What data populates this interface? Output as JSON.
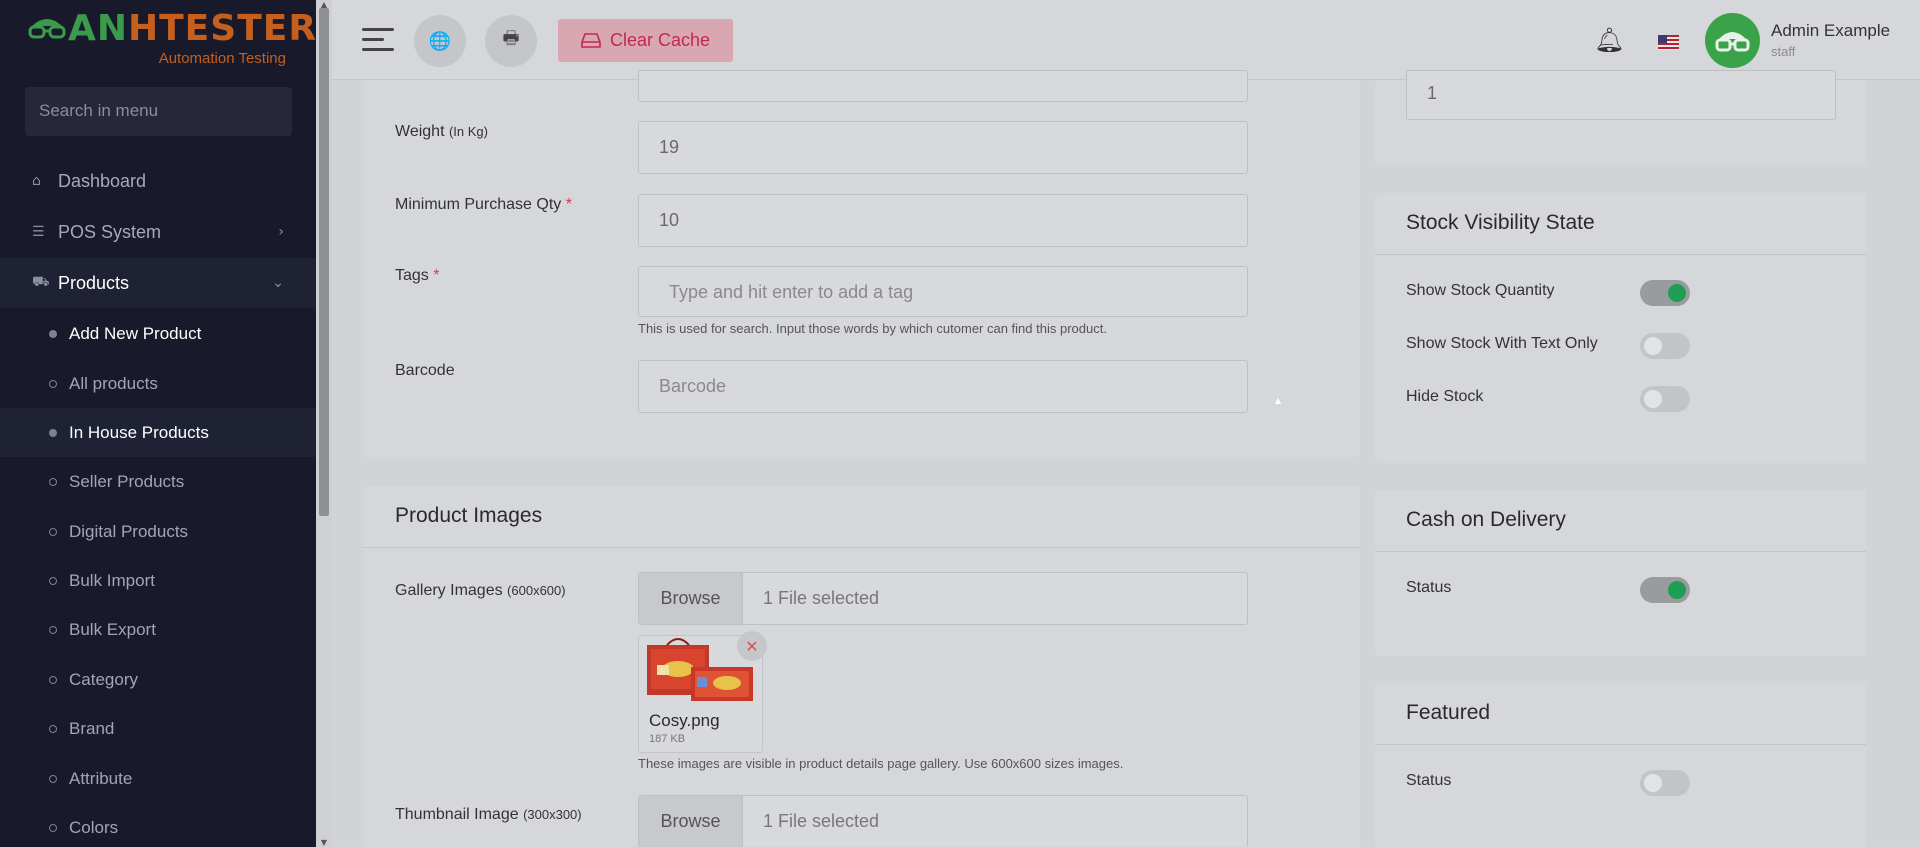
{
  "sidebar": {
    "logo": {
      "brand_prefix": "AN",
      "brand_rest": "HTESTER",
      "subtitle": "Automation Testing"
    },
    "search_placeholder": "Search in menu",
    "items": [
      {
        "label": "Dashboard",
        "icon": "home-icon"
      },
      {
        "label": "POS System",
        "icon": "list-icon"
      },
      {
        "label": "Products",
        "icon": "cart-icon"
      }
    ],
    "sub_items": [
      {
        "label": "Add New Product"
      },
      {
        "label": "All products"
      },
      {
        "label": "In House Products"
      },
      {
        "label": "Seller Products"
      },
      {
        "label": "Digital Products"
      },
      {
        "label": "Bulk Import"
      },
      {
        "label": "Bulk Export"
      },
      {
        "label": "Category"
      },
      {
        "label": "Brand"
      },
      {
        "label": "Attribute"
      },
      {
        "label": "Colors"
      }
    ]
  },
  "topbar": {
    "clear_cache": "Clear Cache",
    "user_name": "Admin Example",
    "user_role": "staff"
  },
  "form": {
    "weight_label": "Weight",
    "weight_unit": "(In Kg)",
    "weight_value": "19",
    "min_qty_label": "Minimum Purchase Qty",
    "min_qty_value": "10",
    "tags_label": "Tags",
    "tags_placeholder": "Type and hit enter to add a tag",
    "tags_hint": "This is used for search. Input those words by which cutomer can find this product.",
    "barcode_label": "Barcode",
    "barcode_placeholder": "Barcode",
    "required_mark": "*"
  },
  "images": {
    "title": "Product Images",
    "gallery_label": "Gallery Images",
    "gallery_size": "(600x600)",
    "browse": "Browse",
    "gallery_file": "1 File selected",
    "thumb_name": "Cosy.png",
    "thumb_size": "187 KB",
    "gallery_hint": "These images are visible in product details page gallery. Use 600x600 sizes images.",
    "thumbnail_label": "Thumbnail Image",
    "thumbnail_size": "(300x300)",
    "thumbnail_file": "1 File selected"
  },
  "right": {
    "top_input_value": "1",
    "stock": {
      "title": "Stock Visibility State",
      "rows": [
        {
          "label": "Show Stock Quantity",
          "on": true
        },
        {
          "label": "Show Stock With Text Only",
          "on": false
        },
        {
          "label": "Hide Stock",
          "on": false
        }
      ]
    },
    "cod": {
      "title": "Cash on Delivery",
      "status_label": "Status",
      "on": true
    },
    "featured": {
      "title": "Featured",
      "status_label": "Status",
      "on": false
    }
  },
  "colors": {
    "sidebar_bg": "#181a2c",
    "accent_green": "#1f9d53",
    "danger": "#c1294f",
    "logo_orange": "#c45f1d",
    "logo_green": "#3a9b4c"
  }
}
